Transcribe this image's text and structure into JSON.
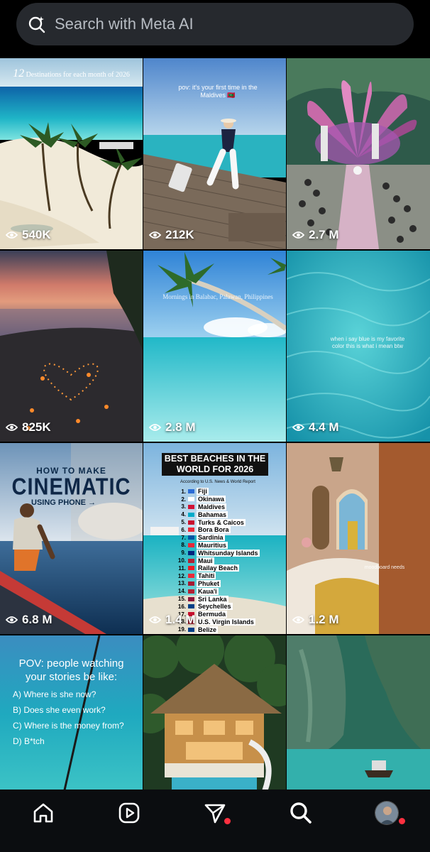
{
  "search": {
    "placeholder": "Search with Meta AI",
    "icon": "meta-ai-search-icon"
  },
  "tiles": [
    {
      "views": "540K",
      "caption_num": "12",
      "caption": "Destinations for each month of 2026"
    },
    {
      "views": "212K",
      "caption": "pov: it's your first time in the Maldives 🇲🇻"
    },
    {
      "views": "2.7 M"
    },
    {
      "views": "825K"
    },
    {
      "views": "2.8 M",
      "caption": "Mornings in Balabac, Palawan, Philippines"
    },
    {
      "views": "4.4 M",
      "caption": "when i say blue is my favorite color this is what i mean btw"
    },
    {
      "views": "6.8 M",
      "caption_a": "HOW TO MAKE",
      "caption_b": "CINEMATIC",
      "caption_c": "USING PHONE →"
    },
    {
      "views": "1.4 M",
      "title": "BEST BEACHES IN THE WORLD FOR 2026",
      "subtitle": "According to U.S. News & World Report",
      "list": [
        {
          "n": "1.",
          "name": "Fiji"
        },
        {
          "n": "2.",
          "name": "Okinawa"
        },
        {
          "n": "3.",
          "name": "Maldives"
        },
        {
          "n": "4.",
          "name": "Bahamas"
        },
        {
          "n": "5.",
          "name": "Turks & Caicos"
        },
        {
          "n": "6.",
          "name": "Bora Bora"
        },
        {
          "n": "7.",
          "name": "Sardinia"
        },
        {
          "n": "8.",
          "name": "Mauritius"
        },
        {
          "n": "9.",
          "name": "Whitsunday Islands"
        },
        {
          "n": "10.",
          "name": "Maui"
        },
        {
          "n": "11.",
          "name": "Railay Beach"
        },
        {
          "n": "12.",
          "name": "Tahiti"
        },
        {
          "n": "13.",
          "name": "Phuket"
        },
        {
          "n": "14.",
          "name": "Kaua'i"
        },
        {
          "n": "15.",
          "name": "Sri Lanka"
        },
        {
          "n": "16.",
          "name": "Seychelles"
        },
        {
          "n": "17.",
          "name": "Bermuda"
        },
        {
          "n": "18.",
          "name": "U.S. Virgin Islands"
        },
        {
          "n": "19.",
          "name": "Belize"
        }
      ]
    },
    {
      "views": "1.2 M",
      "caption": "moodboard needs"
    },
    {
      "title": "POV: people watching your stories be like:",
      "options": [
        "A) Where is she now?",
        "B) Does she even work?",
        "C) Where is the money from?",
        "D) B*tch"
      ]
    },
    {},
    {}
  ],
  "nav": {
    "items": [
      "home-icon",
      "reels-icon",
      "direct-messages-icon",
      "explore-search-icon",
      "profile-avatar"
    ],
    "badge_color": "#ff3040"
  }
}
